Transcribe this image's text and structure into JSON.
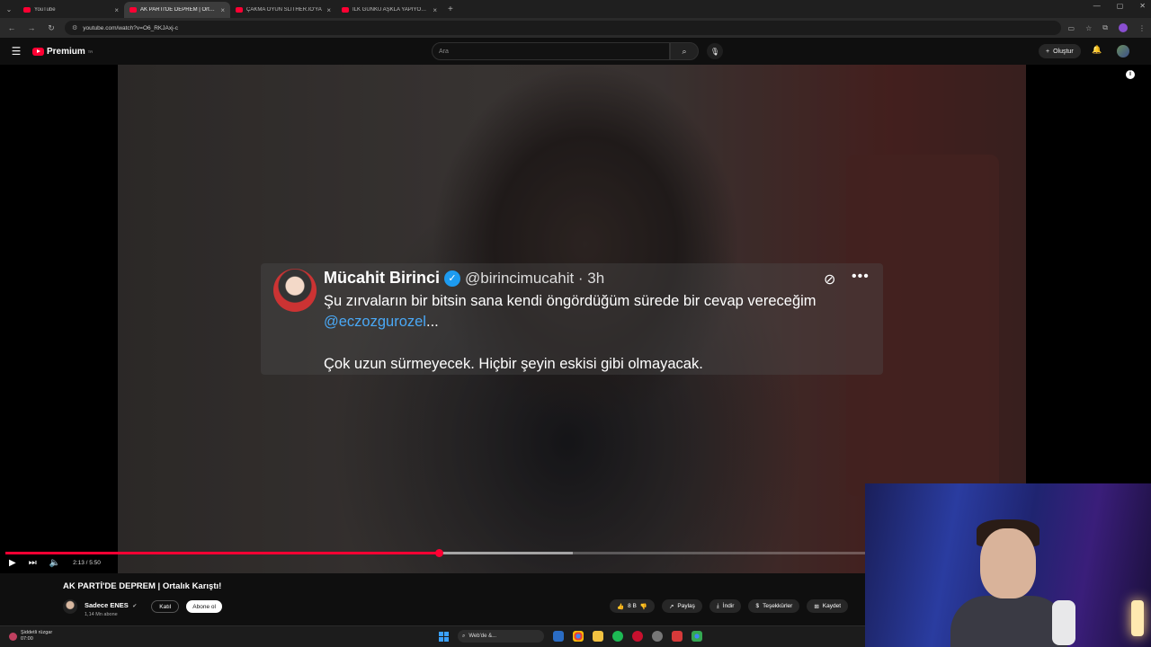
{
  "browser": {
    "tabs": [
      {
        "title": "YouTube",
        "active": false
      },
      {
        "title": "AK PARTİ'DE DEPREM | Ortalık",
        "active": true
      },
      {
        "title": "ÇAKMA OYUN SLITHER.IO'YA",
        "active": false
      },
      {
        "title": "İLK GÜNKÜ AŞKLA YAPIYORUM",
        "active": false
      }
    ],
    "url": "youtube.com/watch?v=O6_RKJAxj-c",
    "new_tab": "+"
  },
  "youtube": {
    "logo_text": "Premium",
    "logo_region": "TR",
    "search_placeholder": "Ara",
    "create_label": "Oluştur"
  },
  "tweet": {
    "name": "Mücahit Birinci",
    "handle": "@birincimucahit · 3h",
    "line1": "Şu zırvaların bir bitsin sana kendi öngördüğüm sürede bir cevap vereceğim",
    "mention": "@eczozgurozel",
    "ellipsis": "...",
    "line3": "Çok uzun sürmeyecek. Hiçbir şeyin eskisi gibi olmayacak."
  },
  "player": {
    "current_time": "2:13 / 5:50",
    "progress": 0.504,
    "buffered": 0.66
  },
  "video": {
    "title": "AK PARTİ'DE DEPREM | Ortalık Karıştı!",
    "channel_name": "Sadece ENES",
    "subscribers": "1,14 Mn abone",
    "join_label": "Katıl",
    "subscribe_label": "Abone ol",
    "likes": "8 B",
    "share_label": "Paylaş",
    "download_label": "İndir",
    "thanks_label": "Teşekkürler",
    "save_label": "Kaydet"
  },
  "taskbar": {
    "weather_line1": "Şiddetli rüzgar",
    "weather_line2": "07:00",
    "search_text": "Web'de &..."
  },
  "colors": {
    "youtube_red": "#ff0033",
    "mention_blue": "#4aa8f5",
    "verified_blue": "#1d9bf0"
  }
}
